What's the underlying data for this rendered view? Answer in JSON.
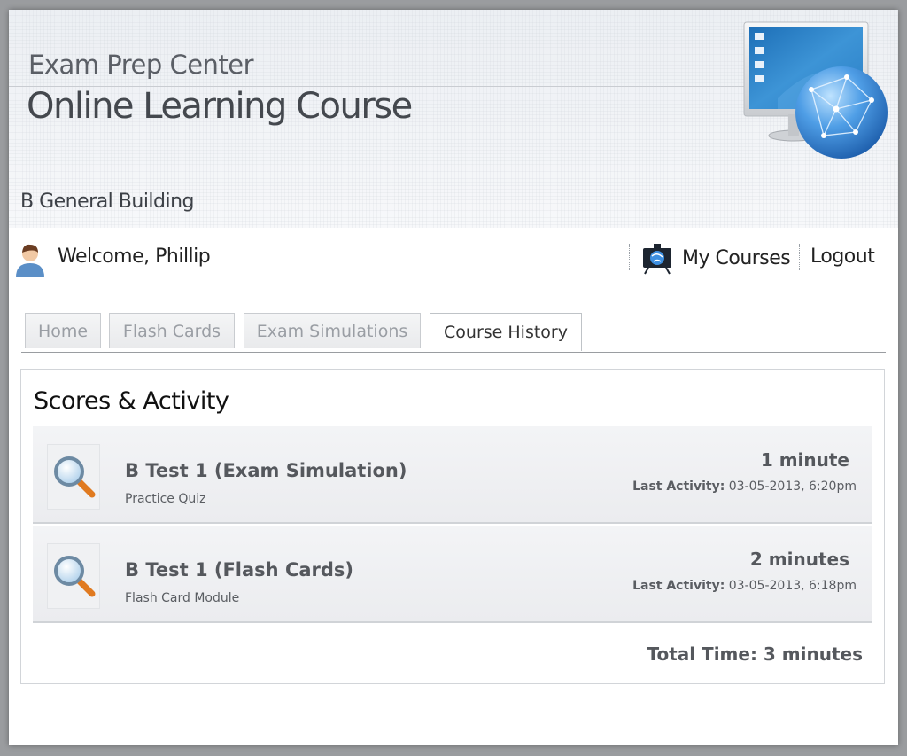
{
  "header": {
    "center_name": "Exam Prep Center",
    "course_title": "Online Learning Course",
    "building": "B General Building",
    "logo_icon": "monitor-globe-icon"
  },
  "topbar": {
    "welcome": "Welcome, Phillip",
    "my_courses": "My Courses",
    "logout": "Logout"
  },
  "tabs": [
    {
      "label": "Home",
      "active": false
    },
    {
      "label": "Flash Cards",
      "active": false
    },
    {
      "label": "Exam Simulations",
      "active": false
    },
    {
      "label": "Course History",
      "active": true
    }
  ],
  "panel": {
    "title": "Scores & Activity",
    "activities": [
      {
        "name": "B Test 1 (Exam Simulation)",
        "type": "Practice Quiz",
        "duration": "1 minute",
        "last_label": "Last Activity:",
        "last_value": "03-05-2013, 6:20pm",
        "icon": "magnifier-icon"
      },
      {
        "name": "B Test 1 (Flash Cards)",
        "type": "Flash Card Module",
        "duration": "2 minutes",
        "last_label": "Last Activity:",
        "last_value": "03-05-2013, 6:18pm",
        "icon": "magnifier-icon"
      }
    ],
    "total": "Total Time: 3 minutes"
  },
  "colors": {
    "page_bg": "#9a9c9f",
    "header_bg": "#eef0f3",
    "row_bg": "#eeeff1",
    "text_gray": "#55585d"
  }
}
